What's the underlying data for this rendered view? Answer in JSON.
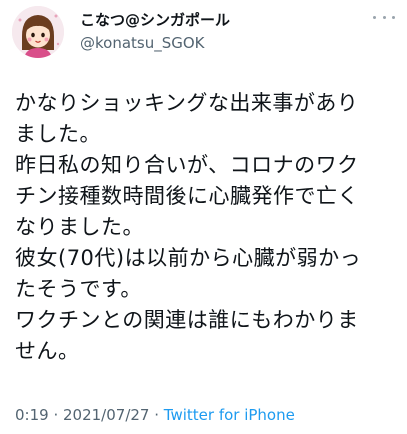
{
  "user": {
    "display_name": "こなつ@シンガポール",
    "handle": "@konatsu_SGOK",
    "avatar_icon": "cartoon-girl-avatar"
  },
  "more_icon": "more-dots-icon",
  "tweet": {
    "lines": [
      "かなりショッキングな出来事があり",
      "ました。",
      "昨日私の知り合いが、コロナのワク",
      "チン接種数時間後に心臓発作で亡く",
      "なりました。",
      "彼女(70代)は以前から心臓が弱かっ",
      "たそうです。",
      "ワクチンとの関連は誰にもわかりま",
      "せん。"
    ]
  },
  "meta": {
    "time": "0:19",
    "separator": " · ",
    "date": "2021/07/27",
    "source": "Twitter for iPhone"
  },
  "colors": {
    "text": "#0f1419",
    "secondary": "#536471",
    "link": "#1d9bf0"
  }
}
